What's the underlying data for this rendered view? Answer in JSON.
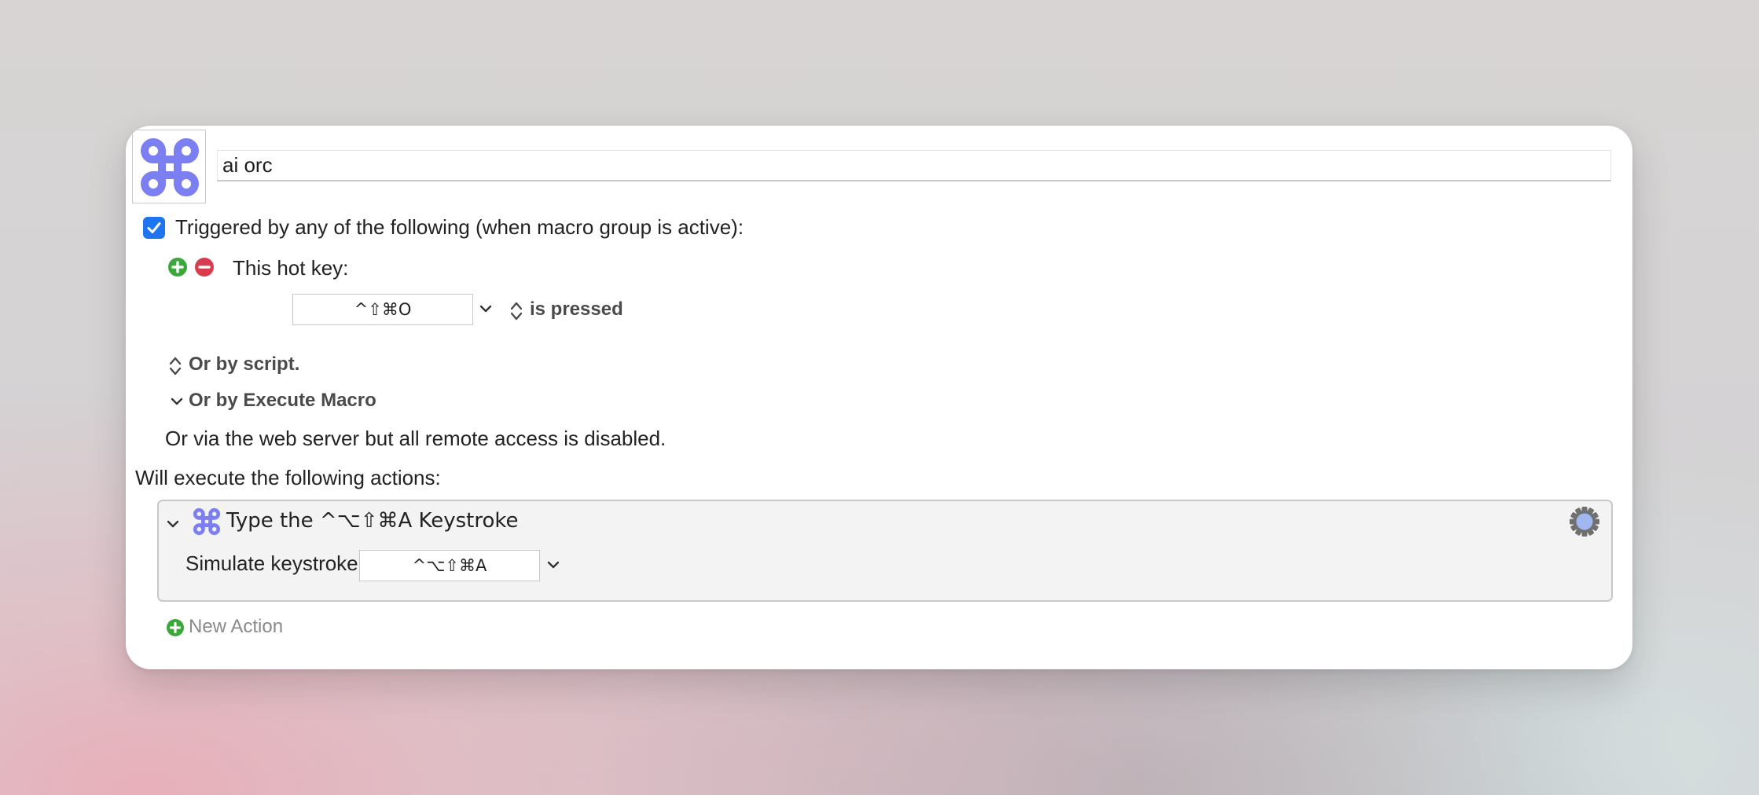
{
  "macro": {
    "name": "ai orc",
    "icon": "command-key-icon",
    "icon_color": "#7b7ff2"
  },
  "trigger": {
    "enabled_label": "Triggered by any of the following (when macro group is active):",
    "hotkey_label": "This hot key:",
    "hotkey_value": "^⇧⌘O",
    "hotkey_condition": "is pressed",
    "script_option": "Or by script.",
    "execute_macro_option": "Or by Execute Macro",
    "web_server_note": "Or via the web server but all remote access is disabled."
  },
  "actions": {
    "header": "Will execute the following actions:",
    "items": [
      {
        "title": "Type the ^⌥⇧⌘A Keystroke",
        "icon": "command-key-icon",
        "field_label": "Simulate keystroke:",
        "keystroke_value": "^⌥⇧⌘A"
      }
    ],
    "new_action_label": "New Action"
  },
  "colors": {
    "checkbox": "#1f74f0",
    "add": "#3aa83a",
    "remove": "#d83c4e",
    "accent_icon": "#7b7ff2"
  }
}
